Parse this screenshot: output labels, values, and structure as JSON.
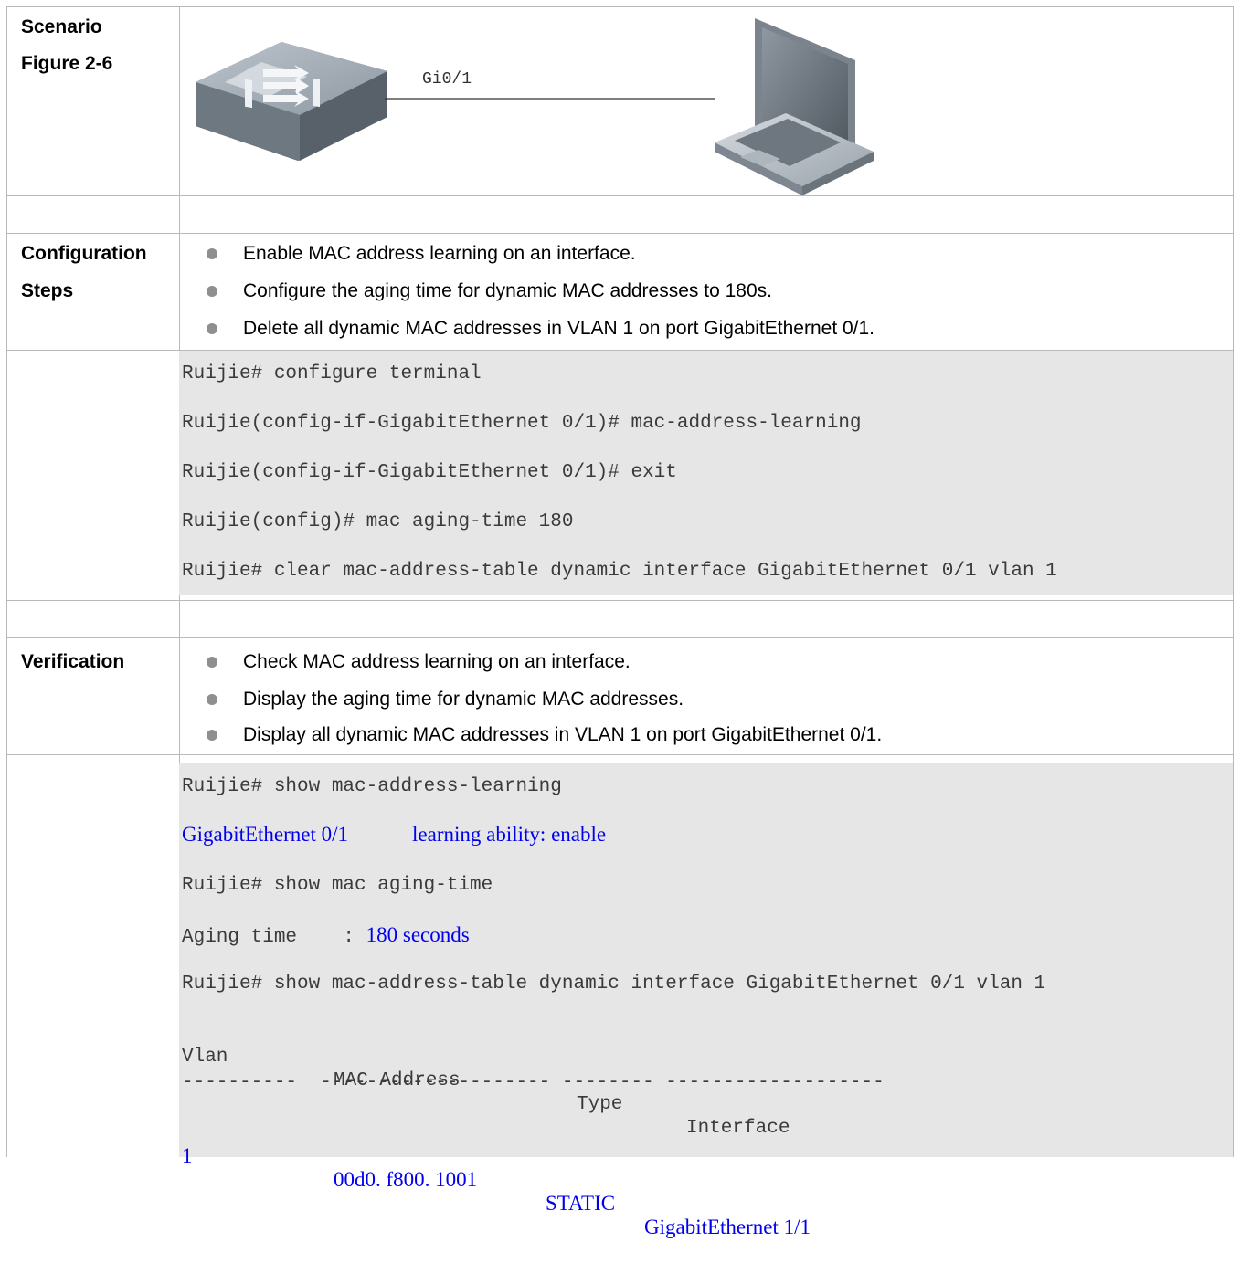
{
  "scenario": {
    "label_1": "Scenario",
    "label_2": "Figure 2-6",
    "port_label": "Gi0/1"
  },
  "configuration": {
    "label_1": "Configuration",
    "label_2": "Steps",
    "steps": [
      "Enable MAC address learning on an interface.",
      "Configure the aging time for dynamic MAC addresses to 180s.",
      "Delete all dynamic MAC addresses in VLAN 1 on port GigabitEthernet 0/1."
    ],
    "code": [
      "Ruijie# configure terminal",
      "Ruijie(config-if-GigabitEthernet 0/1)# mac-address-learning",
      "Ruijie(config-if-GigabitEthernet 0/1)# exit",
      "Ruijie(config)# mac aging-time 180",
      "Ruijie# clear mac-address-table dynamic interface GigabitEthernet 0/1 vlan 1"
    ]
  },
  "verification": {
    "label": "Verification",
    "steps": [
      "Check MAC address learning on an interface.",
      "Display the aging time for dynamic MAC addresses.",
      "Display all dynamic MAC addresses in VLAN 1 on port GigabitEthernet 0/1."
    ],
    "code": {
      "cmd_1": "Ruijie# show mac-address-learning",
      "out_1_port": "GigabitEthernet 0/1",
      "out_1_ability": "learning ability: enable",
      "cmd_2": "Ruijie# show mac aging-time",
      "out_2_label": "Aging time    : ",
      "out_2_value": "180 seconds",
      "cmd_3": "Ruijie# show mac-address-table dynamic interface GigabitEthernet 0/1 vlan 1",
      "header": [
        "Vlan",
        "MAC Address",
        "Type",
        "Interface"
      ],
      "separator": "----------  -------------------- -------- -------------------",
      "row": [
        "1",
        "00d0. f800. 1001",
        "STATIC",
        "GigabitEthernet 1/1"
      ]
    }
  },
  "colors": {
    "code_background": "#e6e6e6",
    "highlight_text": "#0000ee",
    "bullet": "#8f8f8f",
    "border": "#b9b9b9"
  }
}
